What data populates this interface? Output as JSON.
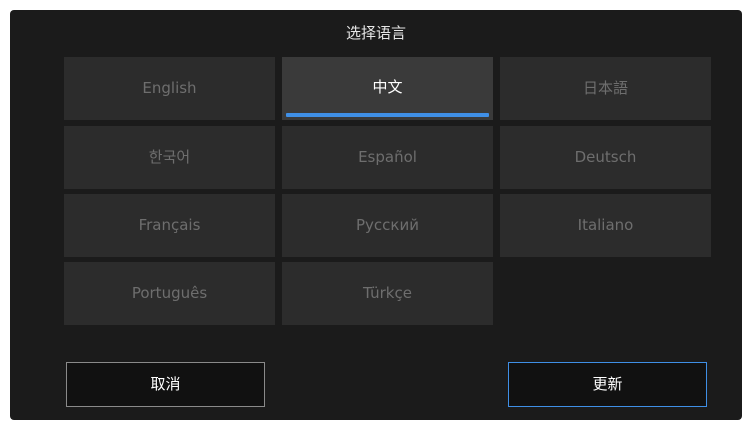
{
  "dialog": {
    "title": "选择语言"
  },
  "languages": [
    {
      "label": "English",
      "selected": false
    },
    {
      "label": "中文",
      "selected": true
    },
    {
      "label": "日本語",
      "selected": false
    },
    {
      "label": "한국어",
      "selected": false
    },
    {
      "label": "Español",
      "selected": false
    },
    {
      "label": "Deutsch",
      "selected": false
    },
    {
      "label": "Français",
      "selected": false
    },
    {
      "label": "Русский",
      "selected": false
    },
    {
      "label": "Italiano",
      "selected": false
    },
    {
      "label": "Português",
      "selected": false
    },
    {
      "label": "Türkçe",
      "selected": false
    }
  ],
  "buttons": {
    "cancel_label": "取消",
    "update_label": "更新"
  },
  "colors": {
    "background": "#1b1b1b",
    "tile": "#2c2c2c",
    "tile_selected": "#3a3a3a",
    "tile_text": "#6e6e6e",
    "accent": "#3f8fe6"
  }
}
